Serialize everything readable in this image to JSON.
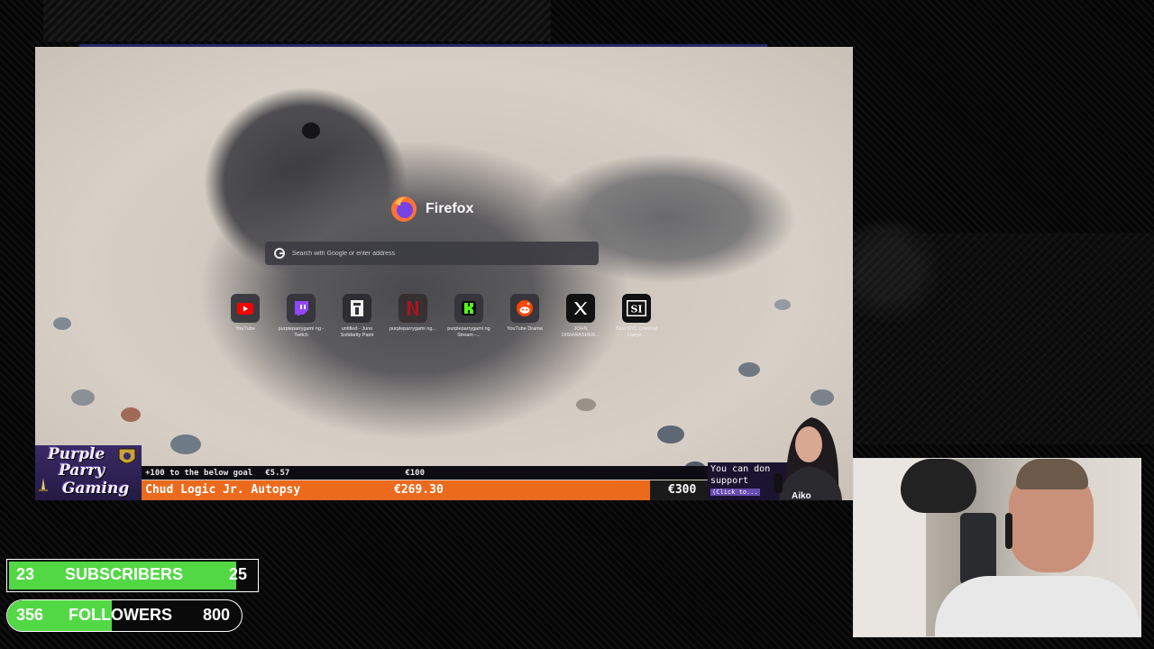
{
  "browser": {
    "app_name": "Firefox",
    "search_placeholder": "Search with Google or enter address",
    "shortcuts": [
      {
        "label": "YouTube",
        "icon": "youtube-icon",
        "color": "#ff0000"
      },
      {
        "label": "purpleparrygami ng - Twitch",
        "icon": "twitch-icon",
        "color": "#9146ff"
      },
      {
        "label": "untitled - June Solidarity Paint",
        "icon": "document-icon",
        "color": "#ffffff"
      },
      {
        "label": "purpleparrygami ng...",
        "icon": "netflix-icon",
        "color": "#e50914"
      },
      {
        "label": "purpleparrygami ng Stream -...",
        "icon": "kick-icon",
        "color": "#53fc18"
      },
      {
        "label": "YouTube Drama",
        "icon": "reddit-icon",
        "color": "#ff4500"
      },
      {
        "label": "JOHN DISHWASHER...",
        "icon": "x-icon",
        "color": "#000000"
      },
      {
        "label": "Best NYC Criminal Lawye...",
        "icon": "si-icon",
        "color": "#000000"
      }
    ]
  },
  "overlay": {
    "logo_lines": [
      "Purple",
      "Parry",
      "Gaming"
    ],
    "goal_top": {
      "text": "+100 to the below goal",
      "amount": "€5.57",
      "target": "€100"
    },
    "goal_main": {
      "text": "Chud Logic Jr. Autopsy",
      "amount": "€269.30",
      "target": "€300",
      "progress": 0.8977
    },
    "chat_lines": [
      "You can don",
      "support"
    ],
    "chat_button": "(Click to...",
    "vtuber_name": "Aiko"
  },
  "counters": {
    "subscribers": {
      "current": "23",
      "label": "SUBSCRIBERS",
      "goal": "25",
      "progress": 0.92
    },
    "followers": {
      "current": "356",
      "label": "FOLLOWERS",
      "goal": "800",
      "progress": 0.445
    }
  },
  "colors": {
    "accent_green": "#53d845",
    "goal_orange": "#ec6a1c",
    "brand_purple": "#3a2a66"
  }
}
